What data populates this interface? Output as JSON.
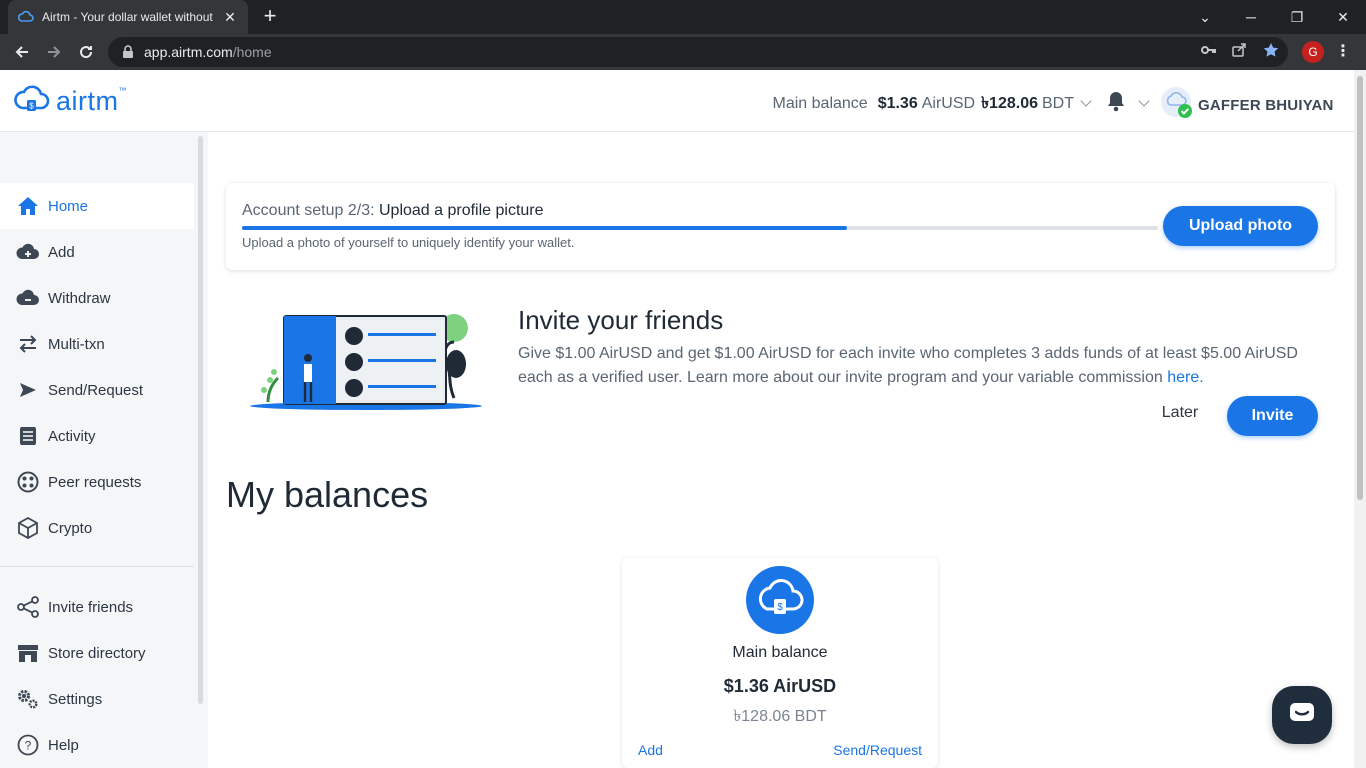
{
  "browser": {
    "tab_title": "Airtm - Your dollar wallet without",
    "tab_close": "✕",
    "new_tab": "+",
    "url_host": "app.airtm.com",
    "url_path": "/home",
    "profile_initial": "G",
    "window_controls": {
      "minimize": "─",
      "restore": "❐",
      "close": "✕",
      "tab_search": "⌄"
    }
  },
  "header": {
    "logo_text": "airtm",
    "logo_tm": "™",
    "balance_label": "Main balance",
    "balance_amount": "$1.36",
    "balance_currency": "AirUSD",
    "balance_local": "৳128.06",
    "balance_local_currency": "BDT",
    "user_name": "GAFFER BHUIYAN"
  },
  "sidebar": {
    "items": [
      {
        "label": "Home",
        "icon": "home-icon"
      },
      {
        "label": "Add",
        "icon": "cloud-add-icon"
      },
      {
        "label": "Withdraw",
        "icon": "cloud-withdraw-icon"
      },
      {
        "label": "Multi-txn",
        "icon": "swap-icon"
      },
      {
        "label": "Send/Request",
        "icon": "send-icon"
      },
      {
        "label": "Activity",
        "icon": "activity-icon"
      },
      {
        "label": "Peer requests",
        "icon": "peer-icon"
      },
      {
        "label": "Crypto",
        "icon": "cube-icon"
      }
    ],
    "bottom_items": [
      {
        "label": "Invite friends",
        "icon": "share-icon"
      },
      {
        "label": "Store directory",
        "icon": "store-icon"
      },
      {
        "label": "Settings",
        "icon": "gear-icon"
      },
      {
        "label": "Help",
        "icon": "help-icon"
      }
    ]
  },
  "setup": {
    "prefix": "Account setup 2/3:",
    "title": "Upload a profile picture",
    "subtitle": "Upload a photo of yourself to uniquely identify your wallet.",
    "progress_fraction": 0.66,
    "button_label": "Upload photo"
  },
  "invite": {
    "title": "Invite your friends",
    "text": "Give $1.00 AirUSD and get $1.00 AirUSD for each invite who completes 3 adds funds of at least $5.00 AirUSD each as a verified user. Learn more about our invite program and your variable commission",
    "link_text": "here.",
    "later_label": "Later",
    "invite_label": "Invite"
  },
  "balances": {
    "title": "My balances",
    "card": {
      "name": "Main balance",
      "amount": "$1.36 AirUSD",
      "local": "৳128.06 BDT",
      "add_label": "Add",
      "send_label": "Send/Request"
    }
  },
  "colors": {
    "accent": "#1a76e6",
    "dark": "#1f2d3d",
    "sidebar_bg": "#f5f6f8"
  }
}
